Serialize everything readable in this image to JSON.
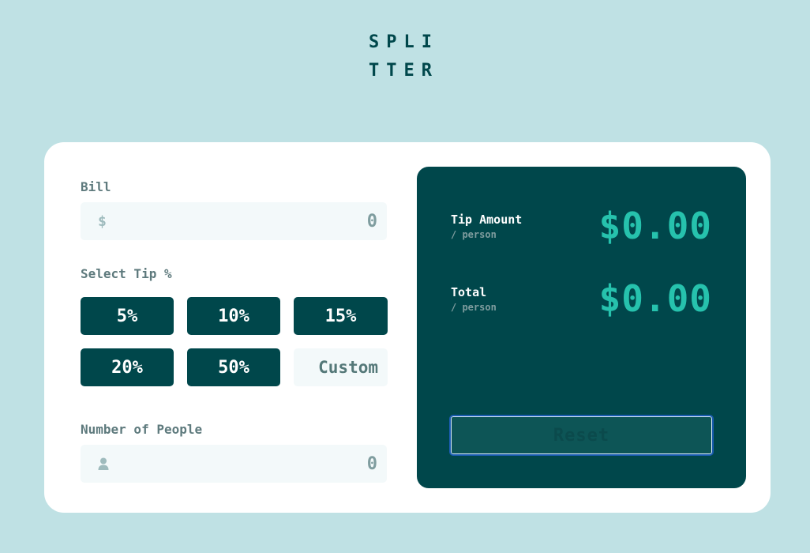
{
  "logo": {
    "line1": "SPLI",
    "line2": "TTER"
  },
  "bill": {
    "label": "Bill",
    "prefix_icon": "dollar-icon",
    "prefix_symbol": "$",
    "placeholder": "0",
    "value": ""
  },
  "tip": {
    "label": "Select Tip %",
    "options": [
      {
        "label": "5%"
      },
      {
        "label": "10%"
      },
      {
        "label": "15%"
      },
      {
        "label": "20%"
      },
      {
        "label": "50%"
      }
    ],
    "custom_placeholder": "Custom"
  },
  "people": {
    "label": "Number of People",
    "prefix_icon": "person-icon",
    "placeholder": "0",
    "value": ""
  },
  "results": {
    "tip_amount": {
      "title": "Tip Amount",
      "sub": "/ person",
      "value": "$0.00"
    },
    "total": {
      "title": "Total",
      "sub": "/ person",
      "value": "$0.00"
    },
    "reset_label": "Reset"
  },
  "colors": {
    "background": "#bfe1e4",
    "dark_cyan": "#00474b",
    "accent": "#26c2ad",
    "input_bg": "#f3f9fa",
    "label_gray": "#5e7a7d"
  }
}
